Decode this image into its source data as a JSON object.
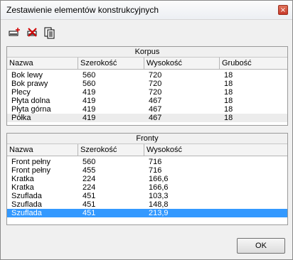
{
  "window": {
    "title": "Zestawienie elementów konstrukcyjnych",
    "close_glyph": "×"
  },
  "toolbar": {
    "buttons": [
      {
        "icon": "add-element-icon"
      },
      {
        "icon": "delete-element-icon"
      },
      {
        "icon": "copy-list-icon"
      }
    ]
  },
  "korpus": {
    "title": "Korpus",
    "columns": [
      "Nazwa",
      "Szerokość",
      "Wysokość",
      "Grubość"
    ],
    "rows": [
      [
        "Bok lewy",
        "560",
        "720",
        "18"
      ],
      [
        "Bok prawy",
        "560",
        "720",
        "18"
      ],
      [
        "Plecy",
        "419",
        "720",
        "18"
      ],
      [
        "Płyta dolna",
        "419",
        "467",
        "18"
      ],
      [
        "Płyta górna",
        "419",
        "467",
        "18"
      ],
      [
        "Półka",
        "419",
        "467",
        "18"
      ]
    ]
  },
  "fronty": {
    "title": "Fronty",
    "columns": [
      "Nazwa",
      "Szerokość",
      "Wysokość"
    ],
    "rows": [
      [
        "Front pełny",
        "560",
        "716"
      ],
      [
        "Front pełny",
        "455",
        "716"
      ],
      [
        "Kratka",
        "224",
        "166,6"
      ],
      [
        "Kratka",
        "224",
        "166,6"
      ],
      [
        "Szuflada",
        "451",
        "103,3"
      ],
      [
        "Szuflada",
        "451",
        "148,8"
      ],
      [
        "Szuflada",
        "451",
        "213,9"
      ]
    ],
    "selected_row": 6
  },
  "buttons": {
    "ok_label": "OK"
  },
  "colors": {
    "selection": "#3399ff",
    "close": "#c8392a"
  }
}
